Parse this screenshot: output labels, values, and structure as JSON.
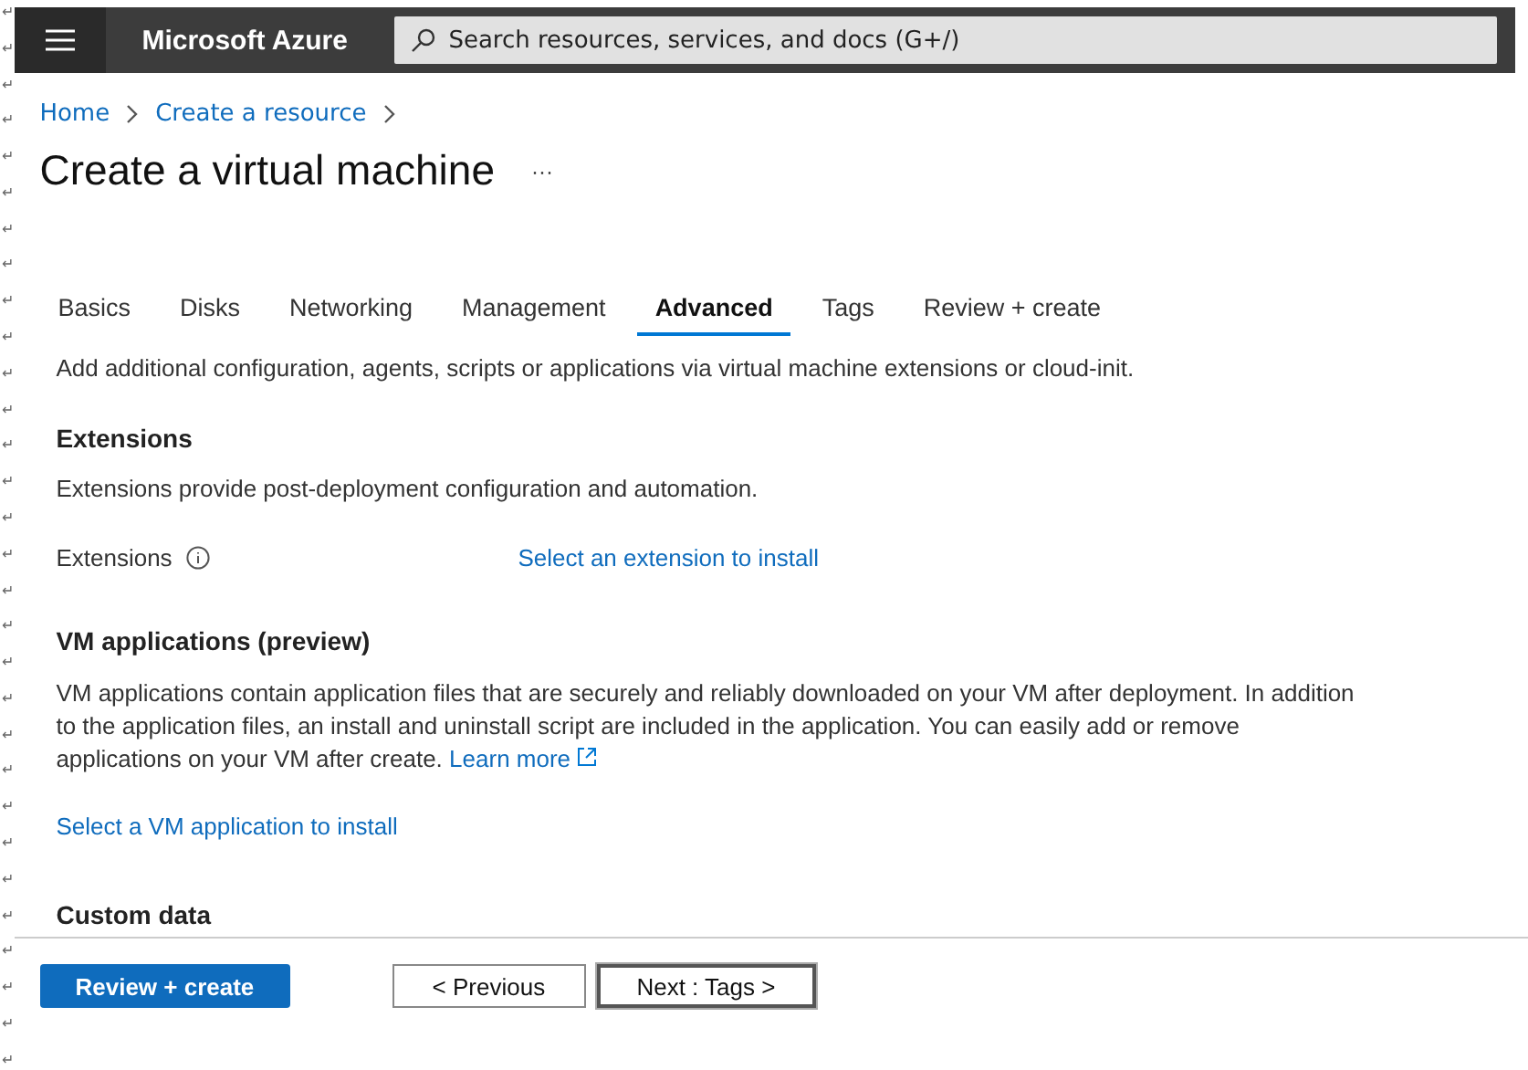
{
  "margin_marks": [
    "↵",
    "↵",
    "↵",
    "↵",
    "↵",
    "↵",
    "↵",
    "↵",
    "↵",
    "↵",
    "↵",
    "↵",
    "↵",
    "↵",
    "↵",
    "↵",
    "↵",
    "↵",
    "↵",
    "↵",
    "↵",
    "↵",
    "↵",
    "↵",
    "↵",
    "↵",
    "↵",
    "↵",
    "↵",
    "↵"
  ],
  "header": {
    "brand": "Microsoft Azure",
    "search": {
      "placeholder": "Search resources, services, and docs (G+/)"
    }
  },
  "breadcrumb": [
    "Home",
    "Create a resource"
  ],
  "page_title": "Create a virtual machine",
  "more": "···",
  "tabs": [
    {
      "label": "Basics",
      "selected": false
    },
    {
      "label": "Disks",
      "selected": false
    },
    {
      "label": "Networking",
      "selected": false
    },
    {
      "label": "Management",
      "selected": false
    },
    {
      "label": "Advanced",
      "selected": true
    },
    {
      "label": "Tags",
      "selected": false
    },
    {
      "label": "Review + create",
      "selected": false
    }
  ],
  "intro": "Add additional configuration, agents, scripts or applications via virtual machine extensions or cloud-init.",
  "extensions": {
    "heading": "Extensions",
    "description": "Extensions provide post-deployment configuration and automation.",
    "field_label": "Extensions",
    "link": "Select an extension to install"
  },
  "vm_applications": {
    "heading": "VM applications (preview)",
    "description": "VM applications contain application files that are securely and reliably downloaded on your VM after deployment. In addition to the application files, an install and uninstall script are included in the application. You can easily add or remove applications on your VM after create.",
    "learn_more": "Learn more",
    "link": "Select a VM application to install"
  },
  "custom_data": {
    "heading": "Custom data"
  },
  "buttons": [
    {
      "label": "Review + create",
      "kind": "primary"
    },
    {
      "label": "< Previous",
      "kind": "secondary"
    },
    {
      "label": "Next : Tags >",
      "kind": "focused"
    }
  ]
}
